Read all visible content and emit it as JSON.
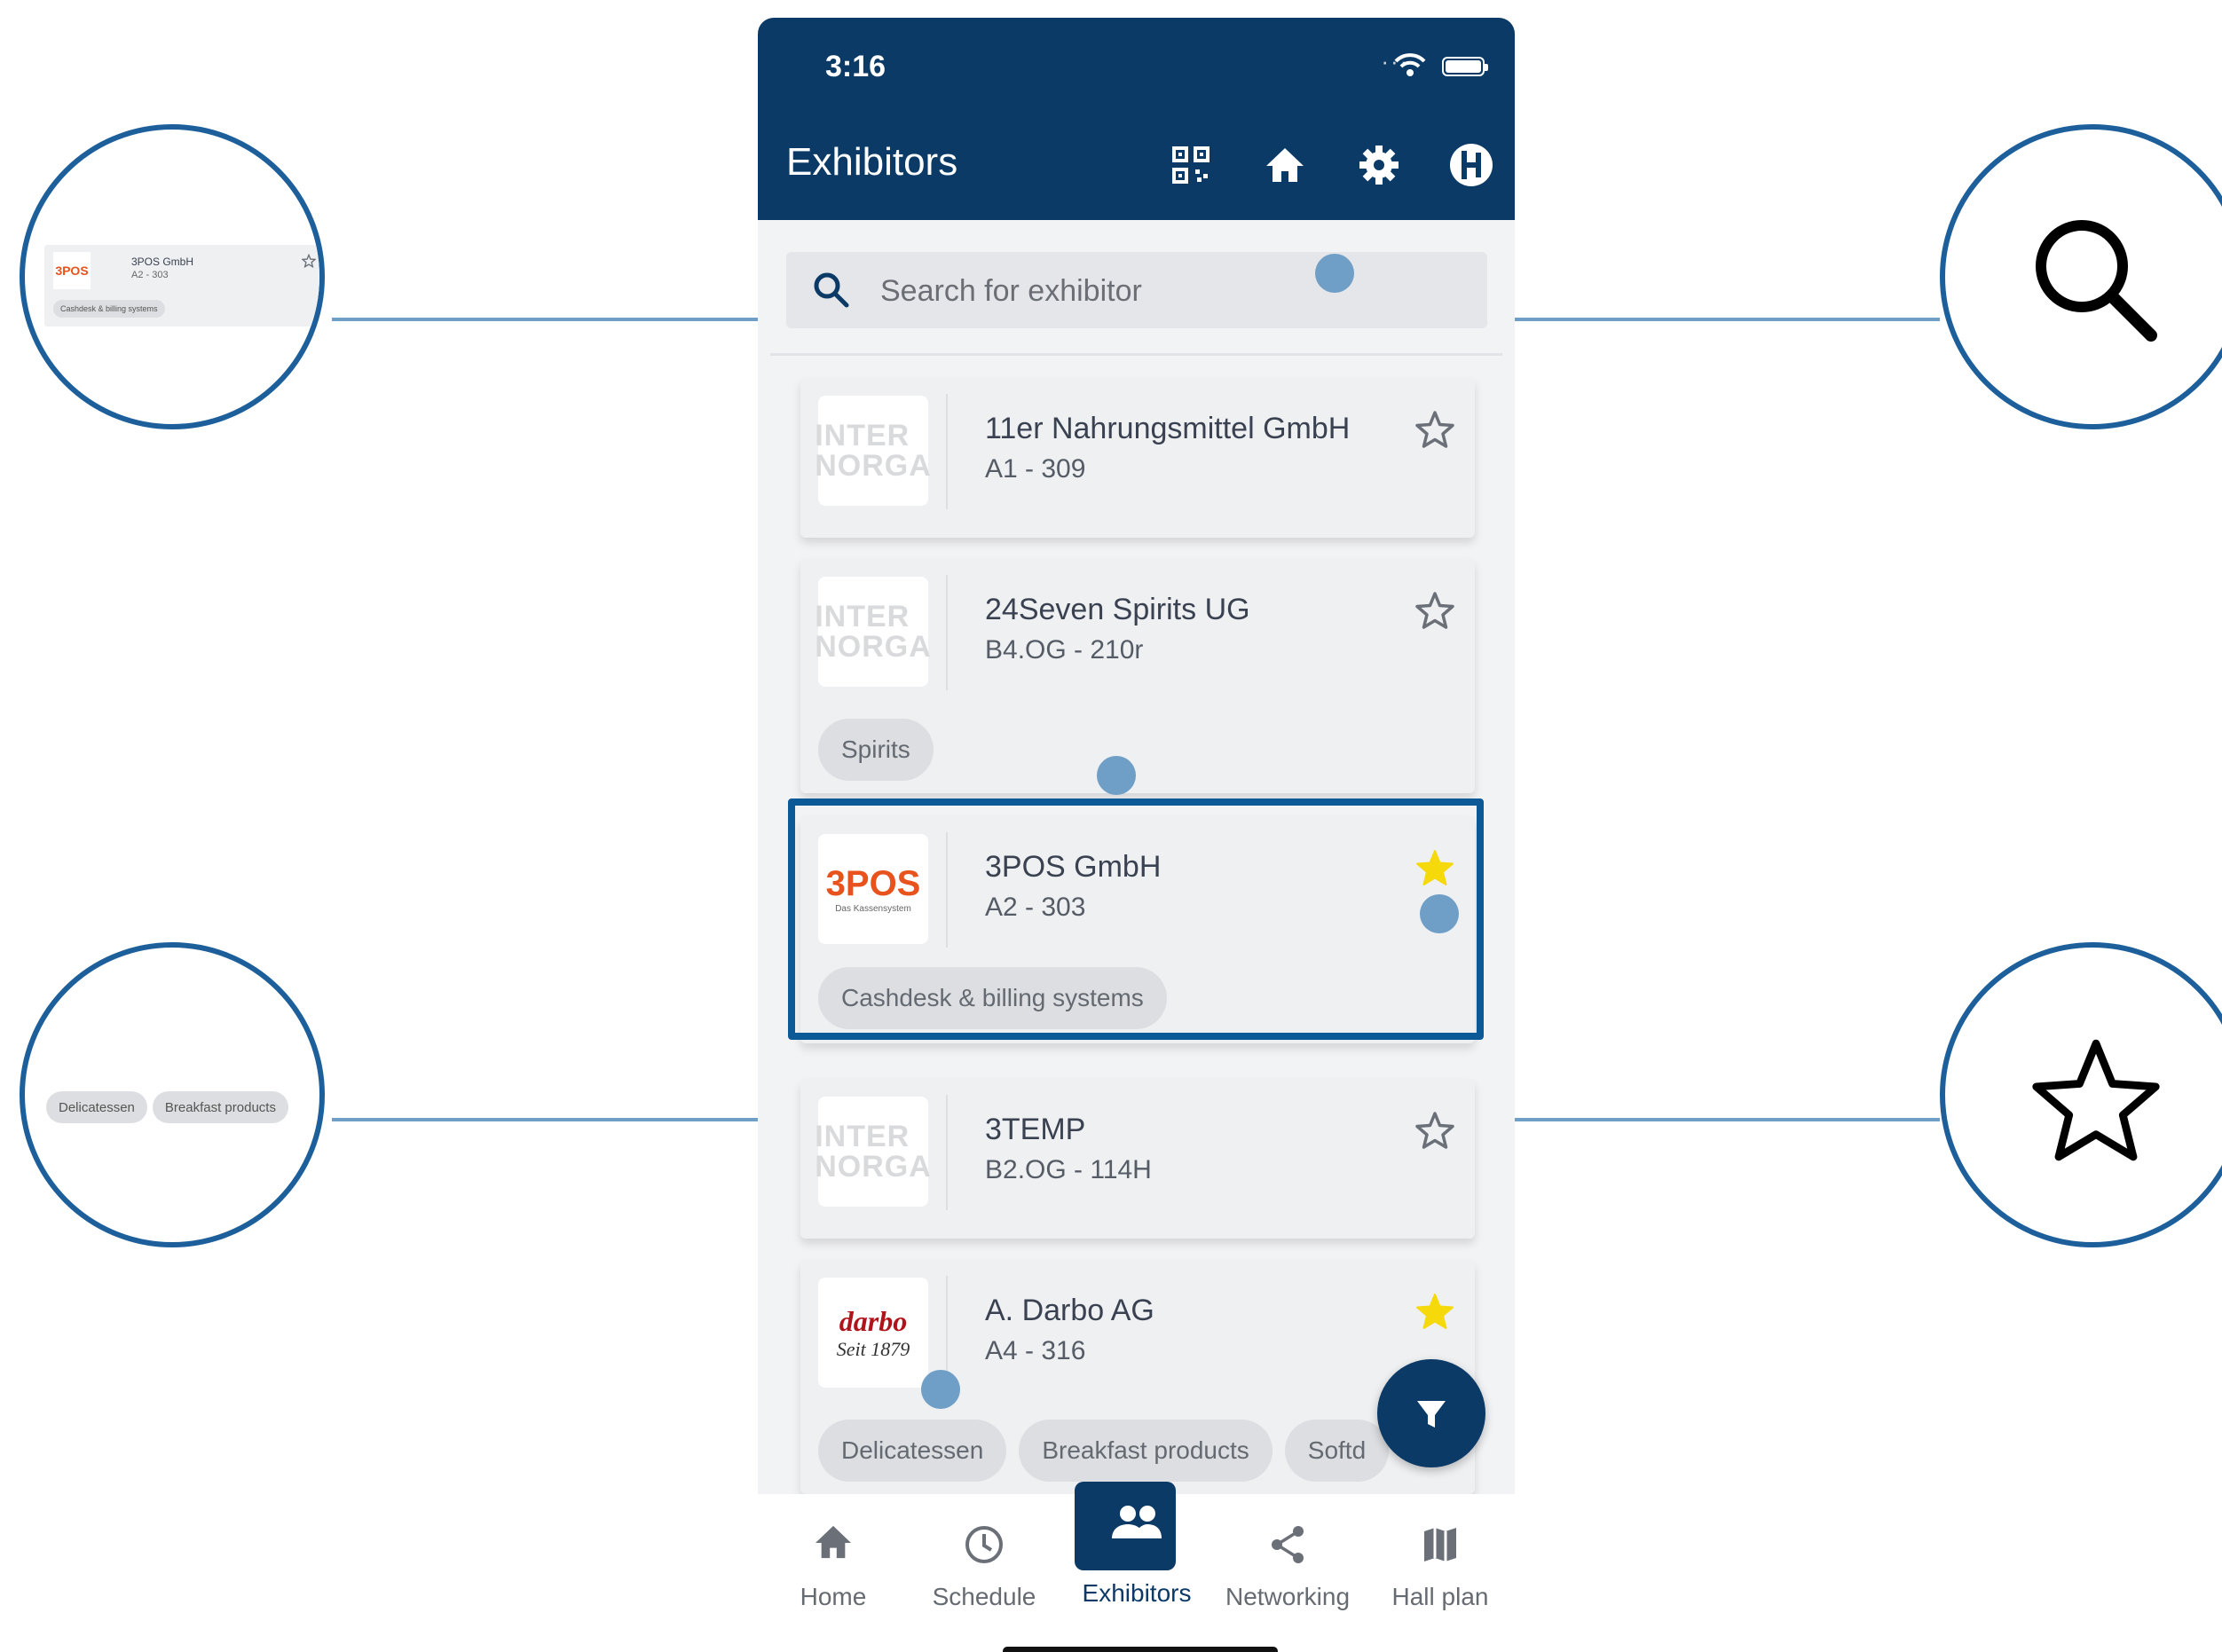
{
  "status_bar": {
    "time": "3:16"
  },
  "app_bar": {
    "title": "Exhibitors",
    "icons": [
      "qr-code-icon",
      "home-icon",
      "gear-icon",
      "profile-icon"
    ]
  },
  "search": {
    "placeholder": "Search for exhibitor"
  },
  "exhibitors": [
    {
      "name": "11er Nahrungsmittel GmbH",
      "booth": "A1 - 309",
      "logo": "INTER\nNORGA",
      "favorite": false,
      "tags": []
    },
    {
      "name": "24Seven Spirits UG",
      "booth": "B4.OG - 210r",
      "logo": "INTER\nNORGA",
      "favorite": false,
      "tags": [
        "Spirits"
      ]
    },
    {
      "name": "3POS GmbH",
      "booth": "A2 - 303",
      "logo": "3POS",
      "logo_sub": "Das Kassensystem",
      "favorite": true,
      "tags": [
        "Cashdesk & billing systems"
      ]
    },
    {
      "name": "3TEMP",
      "booth": "B2.OG - 114H",
      "logo": "INTER\nNORGA",
      "favorite": false,
      "tags": []
    },
    {
      "name": "A. Darbo AG",
      "booth": "A4 - 316",
      "logo": "darbo",
      "logo_sub": "Seit 1879",
      "favorite": true,
      "tags": [
        "Delicatessen",
        "Breakfast products",
        "Softd"
      ]
    }
  ],
  "bottom_nav": [
    {
      "label": "Home",
      "icon": "home-icon"
    },
    {
      "label": "Schedule",
      "icon": "clock-icon"
    },
    {
      "label": "Exhibitors",
      "icon": "people-icon",
      "active": true
    },
    {
      "label": "Networking",
      "icon": "share-icon"
    },
    {
      "label": "Hall plan",
      "icon": "map-icon"
    }
  ],
  "callouts": {
    "card_zoom": {
      "name": "3POS GmbH",
      "booth": "A2 - 303",
      "logo": "3POS",
      "tag": "Cashdesk & billing systems"
    },
    "tags_zoom": {
      "tags": [
        "Delicatessen",
        "Breakfast products"
      ]
    },
    "search_zoom": {
      "icon": "search-icon"
    },
    "favorite_zoom": {
      "icon": "star-outline-icon"
    }
  },
  "colors": {
    "primary": "#0b3a66",
    "accent_star": "#f5d90a",
    "callout": "#1d5f9b",
    "connector": "#6f9ec6"
  }
}
